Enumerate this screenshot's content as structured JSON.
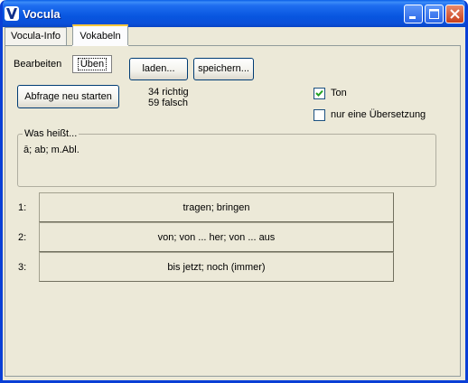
{
  "window": {
    "title": "Vocula"
  },
  "tabs": [
    {
      "label": "Vocula-Info",
      "active": false
    },
    {
      "label": "Vokabeln",
      "active": true
    }
  ],
  "subtabs": [
    {
      "label": "Bearbeiten",
      "active": false
    },
    {
      "label": "Üben",
      "active": true
    }
  ],
  "toolbar": {
    "load_label": "laden...",
    "save_label": "speichern...",
    "restart_label": "Abfrage neu starten"
  },
  "stats": {
    "right": "34 richtig",
    "wrong": "59 falsch"
  },
  "options": {
    "sound": {
      "label": "Ton",
      "checked": true
    },
    "single_translation": {
      "label": "nur eine Übersetzung",
      "checked": false
    }
  },
  "question": {
    "legend": "Was heißt...",
    "text": "ā; ab; m.Abl."
  },
  "answers": [
    {
      "number": "1:",
      "text": "tragen; bringen"
    },
    {
      "number": "2:",
      "text": "von; von ... her; von ... aus"
    },
    {
      "number": "3:",
      "text": "bis jetzt; noch (immer)"
    }
  ],
  "colors": {
    "titlebar": "#0a4fd8",
    "window_bg": "#ece9d8",
    "close_button": "#c8401c"
  }
}
